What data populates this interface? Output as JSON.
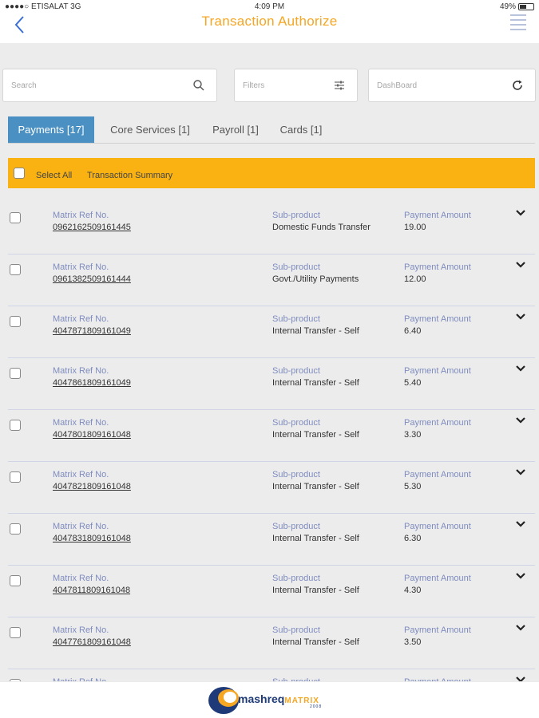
{
  "status_bar": {
    "carrier": "●●●●○ ETISALAT  3G",
    "time": "4:09 PM",
    "battery": "49%",
    "battery_level": 0.49
  },
  "navbar": {
    "title": "Transaction Authorize"
  },
  "search": {
    "placeholder": "Search"
  },
  "filters": {
    "placeholder": "Filters"
  },
  "dashboard": {
    "placeholder": "DashBoard"
  },
  "tabs": [
    {
      "label": "Payments [17]"
    },
    {
      "label": "Core Services [1]"
    },
    {
      "label": "Payroll [1]"
    },
    {
      "label": "Cards [1]"
    }
  ],
  "summary_bar": {
    "select_all": "Select All",
    "transaction_summary": "Transaction Summary"
  },
  "columns": {
    "ref": "Matrix Ref No.",
    "subproduct": "Sub-product",
    "amount": "Payment Amount"
  },
  "rows": [
    {
      "ref": "0962162509161445",
      "subproduct": "Domestic Funds Transfer",
      "amount": "19.00"
    },
    {
      "ref": "0961382509161444",
      "subproduct": "Govt./Utility Payments",
      "amount": "12.00"
    },
    {
      "ref": "4047871809161049",
      "subproduct": "Internal Transfer - Self",
      "amount": "6.40"
    },
    {
      "ref": "4047861809161049",
      "subproduct": "Internal Transfer - Self",
      "amount": "5.40"
    },
    {
      "ref": "4047801809161048",
      "subproduct": "Internal Transfer - Self",
      "amount": "3.30"
    },
    {
      "ref": "4047821809161048",
      "subproduct": "Internal Transfer - Self",
      "amount": "5.30"
    },
    {
      "ref": "4047831809161048",
      "subproduct": "Internal Transfer - Self",
      "amount": "6.30"
    },
    {
      "ref": "4047811809161048",
      "subproduct": "Internal Transfer - Self",
      "amount": "4.30"
    },
    {
      "ref": "4047761809161048",
      "subproduct": "Internal Transfer - Self",
      "amount": "3.50"
    }
  ],
  "footer": {
    "logo_word": "mashreq",
    "logo_matrix": "MATRIX",
    "logo_year": "2008"
  },
  "colors": {
    "accent": "#f5a623",
    "tab_active": "#4a90c2",
    "summary_bar": "#f9b211",
    "label": "#7f8cbf"
  }
}
